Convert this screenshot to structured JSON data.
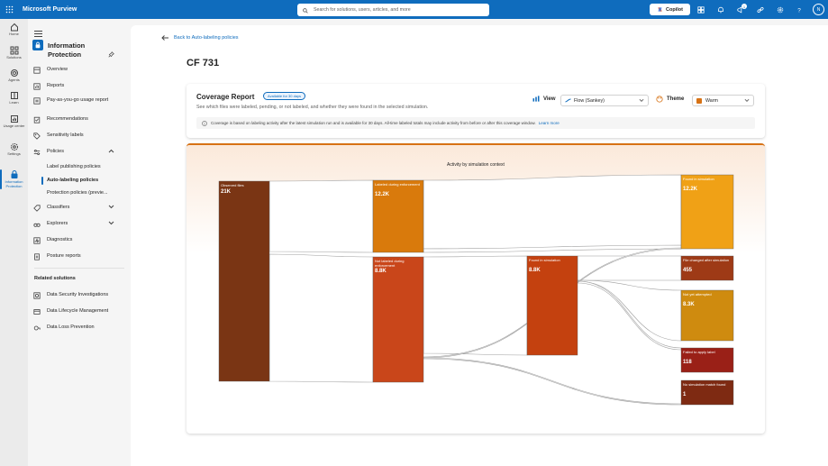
{
  "topbar": {
    "brand": "Microsoft Purview",
    "search_placeholder": "Search for solutions, users, articles, and more",
    "copilot_label": "Copilot",
    "notification_count": "1",
    "avatar_initials": "N"
  },
  "rail": {
    "items": [
      {
        "label": "Home",
        "icon": "home-icon"
      },
      {
        "label": "Solutions",
        "icon": "grid-icon"
      },
      {
        "label": "Agents",
        "icon": "agents-icon"
      },
      {
        "label": "Learn",
        "icon": "book-icon"
      },
      {
        "label": "Usage center",
        "icon": "chart-icon"
      },
      {
        "label": "Settings",
        "icon": "gear-icon"
      },
      {
        "label": "Information Protection",
        "icon": "shield-lock-icon"
      }
    ]
  },
  "nav": {
    "title": "Information Protection",
    "items": {
      "overview": "Overview",
      "reports": "Reports",
      "payg": "Pay-as-you-go usage report",
      "recommendations": "Recommendations",
      "sensitivity": "Sensitivity labels",
      "policies": "Policies",
      "label_publishing": "Label publishing policies",
      "auto_labeling": "Auto-labeling policies",
      "protection": "Protection policies (previe...",
      "classifiers": "Classifiers",
      "explorers": "Explorers",
      "diagnostics": "Diagnostics",
      "posture": "Posture reports"
    },
    "related_heading": "Related solutions",
    "related": {
      "dsi": "Data Security Investigations",
      "dlm": "Data Lifecycle Management",
      "dlp": "Data Loss Prevention"
    }
  },
  "main": {
    "back_label": "Back to Auto-labeling policies",
    "page_title": "CF 731",
    "coverage": {
      "title": "Coverage Report",
      "pill": "Available for 30 days",
      "subtitle": "See which files were labeled, pending, or not labeled, and whether they were found in the selected simulation.",
      "view_label": "View",
      "view_value": "Flow (Sankey)",
      "theme_label": "Theme",
      "theme_value": "Warm",
      "info_text": "Coverage is based on labeling activity after the latest simulation run and is available for 30 days. All-time labeled totals may include activity from before or after this coverage window.",
      "info_link": "Learn more"
    }
  },
  "chart_data": {
    "type": "sankey",
    "title": "Activity by simulation context",
    "nodes": [
      {
        "id": "observed",
        "label": "Observed files",
        "value": "21K",
        "color": "#7a3514"
      },
      {
        "id": "labeled",
        "label": "Labeled during enforcement",
        "value": "12.2K",
        "color": "#d97a0c"
      },
      {
        "id": "notlabeled",
        "label": "Not labeled during enforcement",
        "value": "8.8K",
        "color": "#c9461a"
      },
      {
        "id": "found_mid",
        "label": "Found in simulation",
        "value": "8.8K",
        "color": "#c4410f"
      },
      {
        "id": "found_right",
        "label": "Found in simulation",
        "value": "12.2K",
        "color": "#f0a116"
      },
      {
        "id": "changed",
        "label": "File changed after simulation",
        "value": "455",
        "color": "#9e3a16"
      },
      {
        "id": "notyet",
        "label": "Not yet attempted",
        "value": "8.3K",
        "color": "#cf8b0f"
      },
      {
        "id": "failed",
        "label": "Failed to apply label",
        "value": "118",
        "color": "#9a2017"
      },
      {
        "id": "nomatch",
        "label": "No simulation match found",
        "value": "1",
        "color": "#7e2a12"
      }
    ]
  },
  "colors": {
    "accent": "#0f6cbd",
    "theme_swatch": "#d77215"
  }
}
